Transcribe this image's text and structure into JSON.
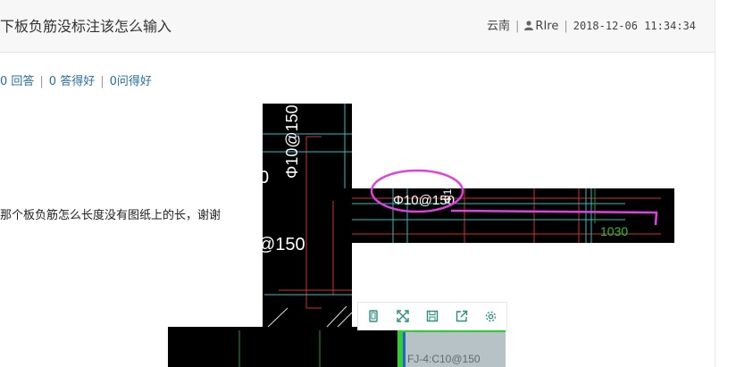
{
  "header": {
    "title": "下板负筋没标注该怎么输入",
    "region": "云南",
    "user": "RIre",
    "timestamp": "2018-12-06 11:34:34"
  },
  "stats": {
    "answers": "0 回答",
    "good_answers": "0 答得好",
    "good_questions": "0问得好"
  },
  "content": {
    "question_text": "那个板负筋怎么长度没有图纸上的长，谢谢"
  },
  "drawing": {
    "labels": {
      "vertical_rebar": "Φ10@150",
      "left_partial": "0",
      "left_rebar": "@150",
      "circled_rebar": "Φ10@150",
      "length_value": "1030",
      "bottom_rebar": "FJ-4:C10@150"
    },
    "colors": {
      "background": "#000000",
      "annotation": "#e040e0",
      "red_line": "#d03030",
      "cyan_line": "#30c0c0",
      "green_text": "#30c030",
      "green_border": "#33cc33"
    }
  },
  "toolbar": {
    "icons": [
      "tablet-icon",
      "fullscreen-icon",
      "save-icon",
      "share-icon",
      "settings-icon"
    ]
  }
}
